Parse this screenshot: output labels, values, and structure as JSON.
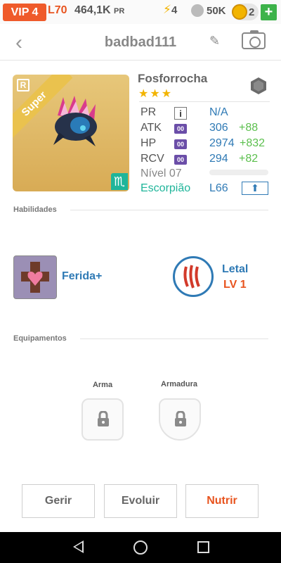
{
  "statusbar": {
    "vip": "VIP 4",
    "level": "L70",
    "power": "464,1K",
    "power_unit": "PR",
    "energy_icon": "lightning-icon",
    "energy": "4",
    "paw_icon": "paw-icon",
    "paw_value": "50K",
    "coin_icon": "coin-icon",
    "coins": "2",
    "plus": "+"
  },
  "header": {
    "back_icon": "chevron-left-icon",
    "title": "badbad111",
    "edit_icon": "pencil-icon",
    "camera_icon": "camera-icon"
  },
  "monster": {
    "rarity_badge": "R",
    "ribbon": "Super",
    "zodiac_sign": "♏",
    "name": "Fosforrocha",
    "stars": "★★★",
    "element_icon": "rock-element-icon",
    "stats": [
      {
        "label": "PR",
        "tag": "i",
        "value": "N/A",
        "bonus": ""
      },
      {
        "label": "ATK",
        "tag": "00",
        "value": "306",
        "bonus": "+88"
      },
      {
        "label": "HP",
        "tag": "00",
        "value": "2974",
        "bonus": "+832"
      },
      {
        "label": "RCV",
        "tag": "00",
        "value": "294",
        "bonus": "+82"
      }
    ],
    "level_text": "Nível 07",
    "level_progress": 0,
    "zodiac": "Escorpião",
    "required_level": "L66",
    "upgrade_icon": "arrow-up-icon"
  },
  "skills": {
    "title": "Habilidades",
    "items": [
      {
        "name": "Ferida+",
        "icon": "cross-heart-icon"
      },
      {
        "name": "Letal",
        "level": "LV 1",
        "icon": "claw-icon"
      }
    ]
  },
  "equipment": {
    "title": "Equipamentos",
    "slots": [
      {
        "label": "Arma",
        "icon": "lock-icon"
      },
      {
        "label": "Armadura",
        "icon": "lock-icon"
      }
    ]
  },
  "actions": {
    "manage": "Gerir",
    "evolve": "Evoluir",
    "feed": "Nutrir"
  },
  "navbar": {
    "back_icon": "nav-back-icon",
    "home_icon": "nav-home-icon",
    "recent_icon": "nav-recent-icon"
  },
  "colors": {
    "accent_orange": "#e8541f",
    "accent_blue": "#2f7ab5",
    "bonus_green": "#5bbf4d",
    "zodiac_teal": "#1fb59a"
  }
}
